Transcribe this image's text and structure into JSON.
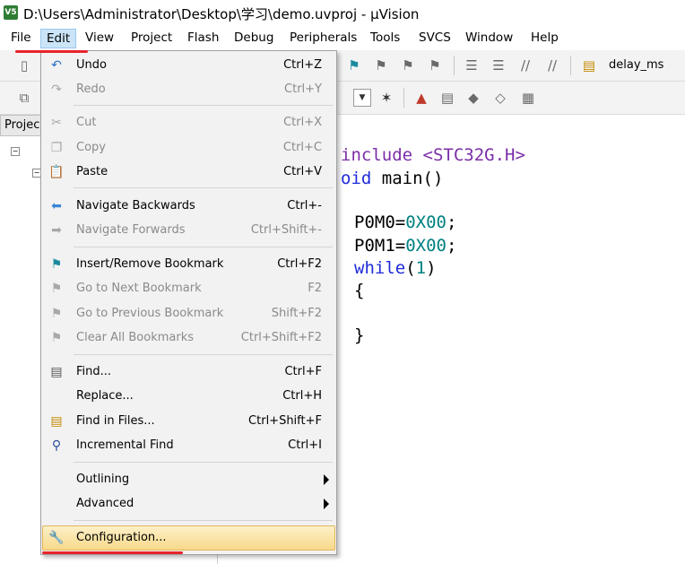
{
  "window": {
    "app_icon_text": "V5",
    "title": "D:\\Users\\Administrator\\Desktop\\学习\\demo.uvproj - µVision"
  },
  "menubar": {
    "items": [
      "File",
      "Edit",
      "View",
      "Project",
      "Flash",
      "Debug",
      "Peripherals",
      "Tools",
      "SVCS",
      "Window",
      "Help"
    ]
  },
  "toolbar": {
    "target_label": "delay_ms"
  },
  "project_panel": {
    "tab_label": "Projec"
  },
  "editor": {
    "lines": {
      "l1_pp": "include",
      "l1_hdr": "<STC32G.H>",
      "l2_kw": "oid",
      "l2_rest": " main()",
      "l3_lhs": "P0M0=",
      "l3_num": "0X00",
      "l3_end": ";",
      "l4_lhs": "P0M1=",
      "l4_num": "0X00",
      "l4_end": ";",
      "l5_kw": "while",
      "l5_open": "(",
      "l5_num": "1",
      "l5_close": ")",
      "l6": "{",
      "l7": "}"
    }
  },
  "edit_menu": {
    "items": [
      {
        "label": "Undo",
        "shortcut": "Ctrl+Z",
        "enabled": true,
        "icon": "undo-icon"
      },
      {
        "label": "Redo",
        "shortcut": "Ctrl+Y",
        "enabled": false,
        "icon": "redo-icon"
      },
      {
        "label": "Cut",
        "shortcut": "Ctrl+X",
        "enabled": false,
        "icon": "cut-icon"
      },
      {
        "label": "Copy",
        "shortcut": "Ctrl+C",
        "enabled": false,
        "icon": "copy-icon"
      },
      {
        "label": "Paste",
        "shortcut": "Ctrl+V",
        "enabled": true,
        "icon": "paste-icon"
      },
      {
        "label": "Navigate Backwards",
        "shortcut": "Ctrl+-",
        "enabled": true,
        "icon": "back-arrow-icon"
      },
      {
        "label": "Navigate Forwards",
        "shortcut": "Ctrl+Shift+-",
        "enabled": false,
        "icon": "forward-arrow-icon"
      },
      {
        "label": "Insert/Remove Bookmark",
        "shortcut": "Ctrl+F2",
        "enabled": true,
        "icon": "bookmark-icon"
      },
      {
        "label": "Go to Next Bookmark",
        "shortcut": "F2",
        "enabled": false,
        "icon": "next-bookmark-icon"
      },
      {
        "label": "Go to Previous Bookmark",
        "shortcut": "Shift+F2",
        "enabled": false,
        "icon": "prev-bookmark-icon"
      },
      {
        "label": "Clear All Bookmarks",
        "shortcut": "Ctrl+Shift+F2",
        "enabled": false,
        "icon": "clear-bookmarks-icon"
      },
      {
        "label": "Find...",
        "shortcut": "Ctrl+F",
        "enabled": true,
        "icon": "find-icon"
      },
      {
        "label": "Replace...",
        "shortcut": "Ctrl+H",
        "enabled": true,
        "icon": ""
      },
      {
        "label": "Find in Files...",
        "shortcut": "Ctrl+Shift+F",
        "enabled": true,
        "icon": "find-in-files-icon"
      },
      {
        "label": "Incremental Find",
        "shortcut": "Ctrl+I",
        "enabled": true,
        "icon": "binoculars-icon"
      },
      {
        "label": "Outlining",
        "shortcut": "",
        "enabled": true,
        "icon": ""
      },
      {
        "label": "Advanced",
        "shortcut": "",
        "enabled": true,
        "icon": ""
      },
      {
        "label": "Configuration...",
        "shortcut": "",
        "enabled": true,
        "icon": "wrench-icon"
      }
    ]
  },
  "colors": {
    "annotation_red": "#e8242c",
    "highlight": "#f7d98a",
    "keyword_blue": "#1e2bd8",
    "preprocessor_purple": "#7b2ea8",
    "number_teal": "#008080"
  }
}
